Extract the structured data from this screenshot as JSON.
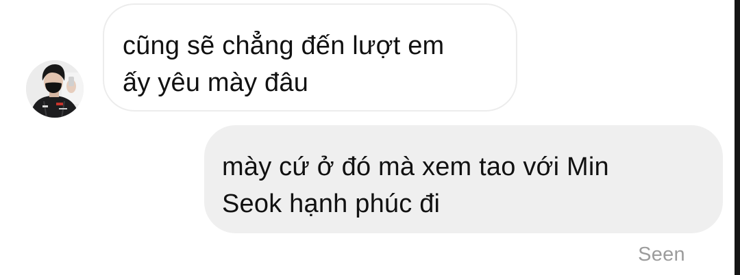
{
  "messages": [
    {
      "direction": "incoming",
      "lines": [
        "cũng sẽ chẳng đến lượt em",
        "ấy yêu mày đâu"
      ]
    },
    {
      "direction": "outgoing",
      "lines": [
        "mày cứ ở đó mà xem tao với Min",
        "Seok hạnh phúc đi"
      ]
    }
  ],
  "status": {
    "seen_label": "Seen"
  },
  "colors": {
    "incoming_bubble": "#ffffff",
    "incoming_border": "#ececec",
    "outgoing_bubble": "#efefef",
    "text": "#111111",
    "status_text": "#9c9c9c"
  },
  "icons": {
    "avatar": "profile-photo"
  }
}
